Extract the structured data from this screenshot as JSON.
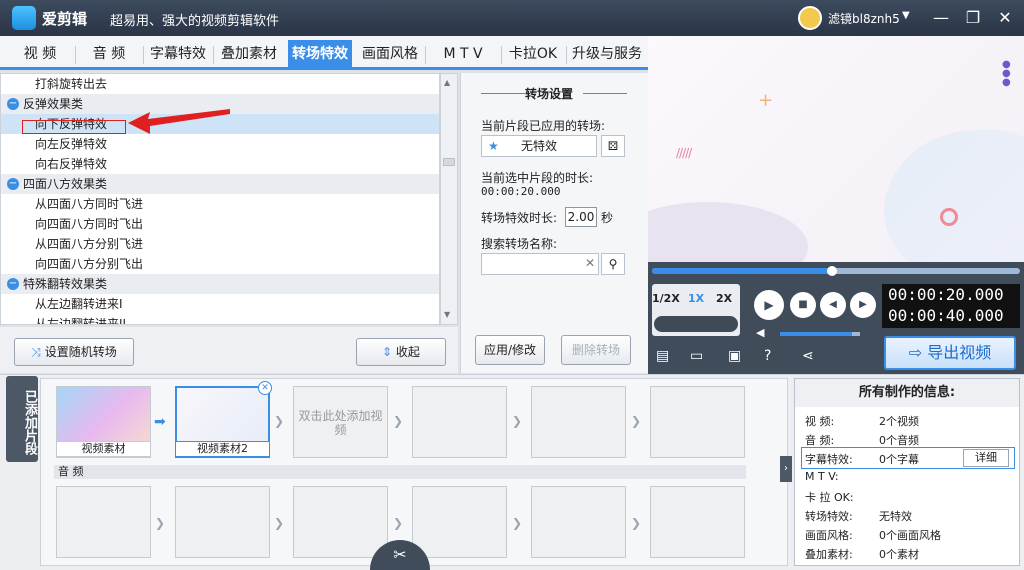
{
  "app": {
    "name": "爱剪辑",
    "tagline": "超易用、强大的视频剪辑软件",
    "username": "滤镜bl8znh5"
  },
  "tabs": [
    "视 频",
    "音 频",
    "字幕特效",
    "叠加素材",
    "转场特效",
    "画面风格",
    "M T V",
    "卡拉OK",
    "升级与服务"
  ],
  "list": [
    {
      "type": "item",
      "label": "打斜旋转出去"
    },
    {
      "type": "cat",
      "label": "反弹效果类"
    },
    {
      "type": "item",
      "label": "向下反弹特效",
      "selected": true
    },
    {
      "type": "item",
      "label": "向左反弹特效"
    },
    {
      "type": "item",
      "label": "向右反弹特效"
    },
    {
      "type": "cat",
      "label": "四面八方效果类"
    },
    {
      "type": "item",
      "label": "从四面八方同时飞进"
    },
    {
      "type": "item",
      "label": "向四面八方同时飞出"
    },
    {
      "type": "item",
      "label": "从四面八方分别飞进"
    },
    {
      "type": "item",
      "label": "向四面八方分别飞出"
    },
    {
      "type": "cat",
      "label": "特殊翻转效果类"
    },
    {
      "type": "item",
      "label": "从左边翻转进来I"
    },
    {
      "type": "item",
      "label": "从左边翻转进来II"
    }
  ],
  "buttons": {
    "random": "设置随机转场",
    "collapse": "收起",
    "apply": "应用/修改",
    "delete": "删除转场"
  },
  "settings": {
    "title": "转场设置",
    "applied_label": "当前片段已应用的转场:",
    "applied_value": "无特效",
    "duration_label": "当前选中片段的时长:",
    "duration_value": "00:00:20.000",
    "effect_duration_label": "转场特效时长:",
    "effect_duration_value": "2.00",
    "sec": "秒",
    "search_label": "搜索转场名称:",
    "search_value": ""
  },
  "player": {
    "speeds": [
      "1/2X",
      "1X",
      "2X"
    ],
    "time_current": "00:00:20.000",
    "time_total": "00:00:40.000",
    "export_label": "导出视频",
    "progress": 0.49,
    "volume": 0.9
  },
  "timeline": {
    "side_label": "已添加片段",
    "clips": [
      "视频素材",
      "视频素材2"
    ],
    "add_hint": "双击此处添加视频",
    "audio_label": "音 频"
  },
  "info": {
    "title": "所有制作的信息:",
    "detail_btn": "详细",
    "rows": [
      {
        "label": "视    频:",
        "value": "2个视频"
      },
      {
        "label": "音    频:",
        "value": "0个音频"
      },
      {
        "label": "字幕特效:",
        "value": "0个字幕"
      },
      {
        "label": "M  T  V:",
        "value": ""
      },
      {
        "label": "卡 拉 OK:",
        "value": ""
      },
      {
        "label": "转场特效:",
        "value": "无特效"
      },
      {
        "label": "画面风格:",
        "value": "0个画面风格"
      },
      {
        "label": "叠加素材:",
        "value": "0个素材"
      }
    ]
  },
  "colors": {
    "accent": "#3b8ee8",
    "title_bg": "#2f3b4d",
    "highlight": "#cfe3f7",
    "red": "#e02020"
  }
}
